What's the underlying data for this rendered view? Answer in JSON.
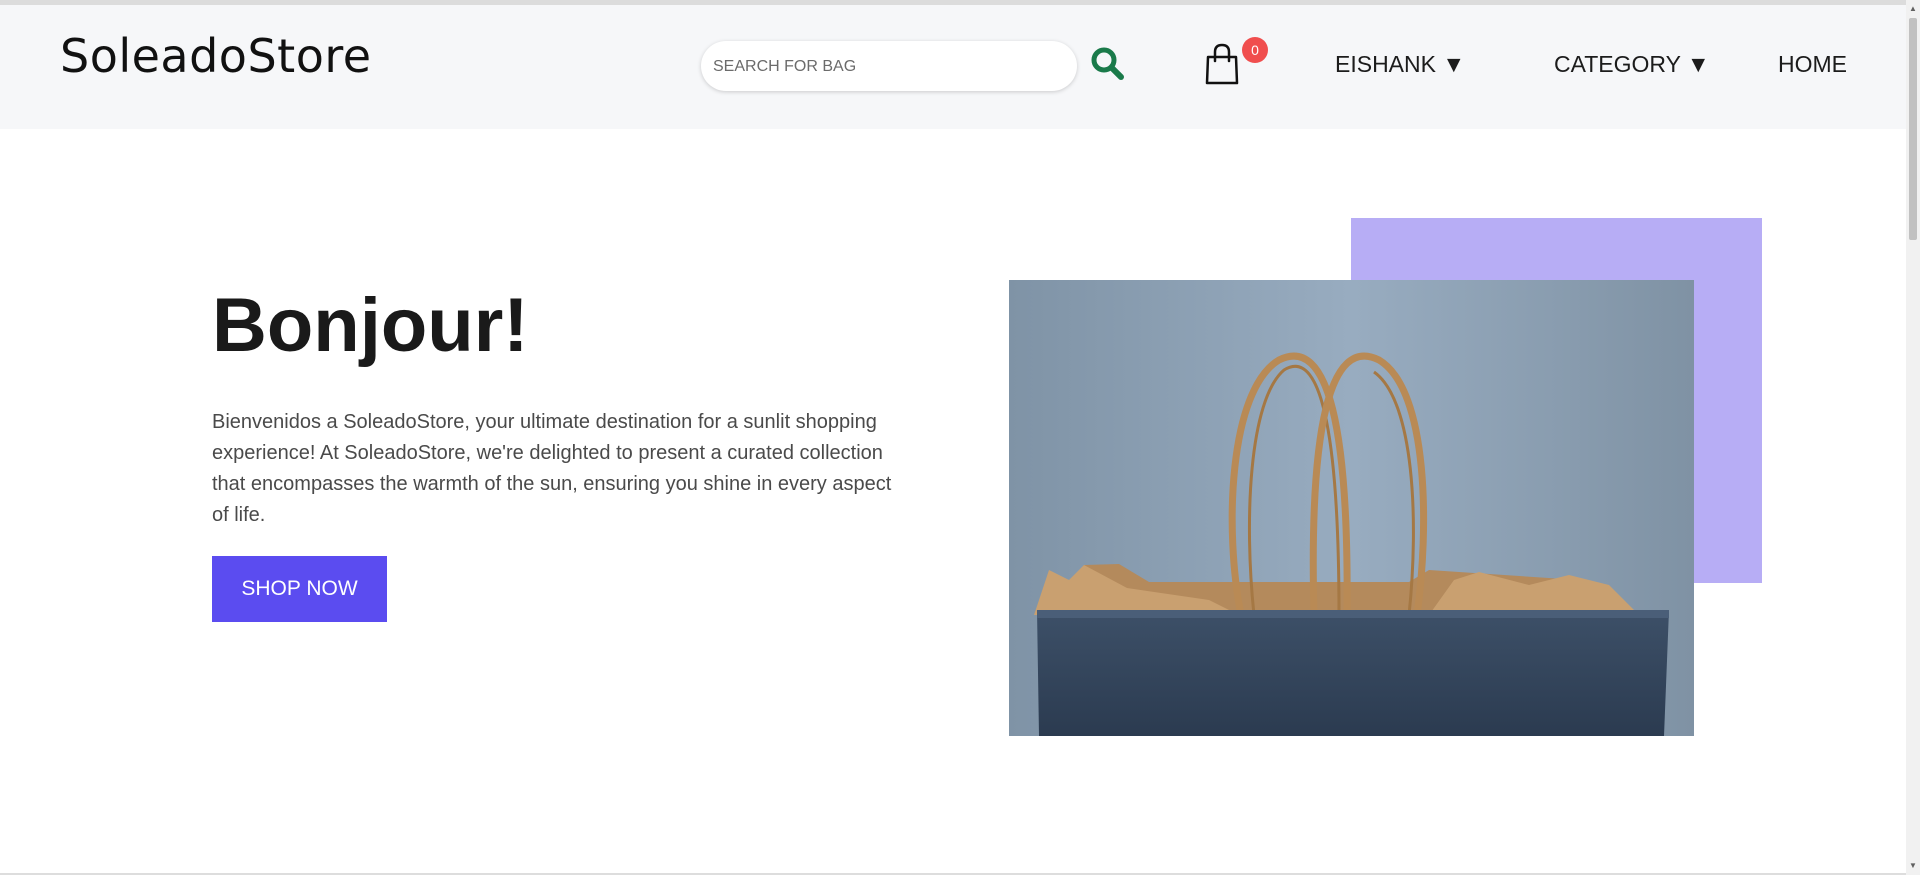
{
  "header": {
    "logo": "SoleadoStore",
    "search": {
      "placeholder": "SEARCH FOR BAG",
      "value": ""
    },
    "cart_count": "0",
    "nav": [
      {
        "label": "EISHANK ▼"
      },
      {
        "label": "CATEGORY ▼"
      },
      {
        "label": "HOME"
      }
    ]
  },
  "hero": {
    "title": "Bonjour!",
    "text": "Bienvenidos a SoleadoStore, your ultimate destination for a sunlit shopping experience! At SoleadoStore, we're delighted to present a curated collection that encompasses the warmth of the sun, ensuring you shine in every aspect of life.",
    "button_label": "SHOP NOW"
  },
  "colors": {
    "accent": "#5b4cf0",
    "accent_box": "#b7adf5",
    "search_icon": "#1a7a4a",
    "badge": "#f04e4e",
    "navbar_bg": "#f6f7f9"
  },
  "icons": {
    "search": "search-icon",
    "cart": "shopping-bag-icon"
  }
}
